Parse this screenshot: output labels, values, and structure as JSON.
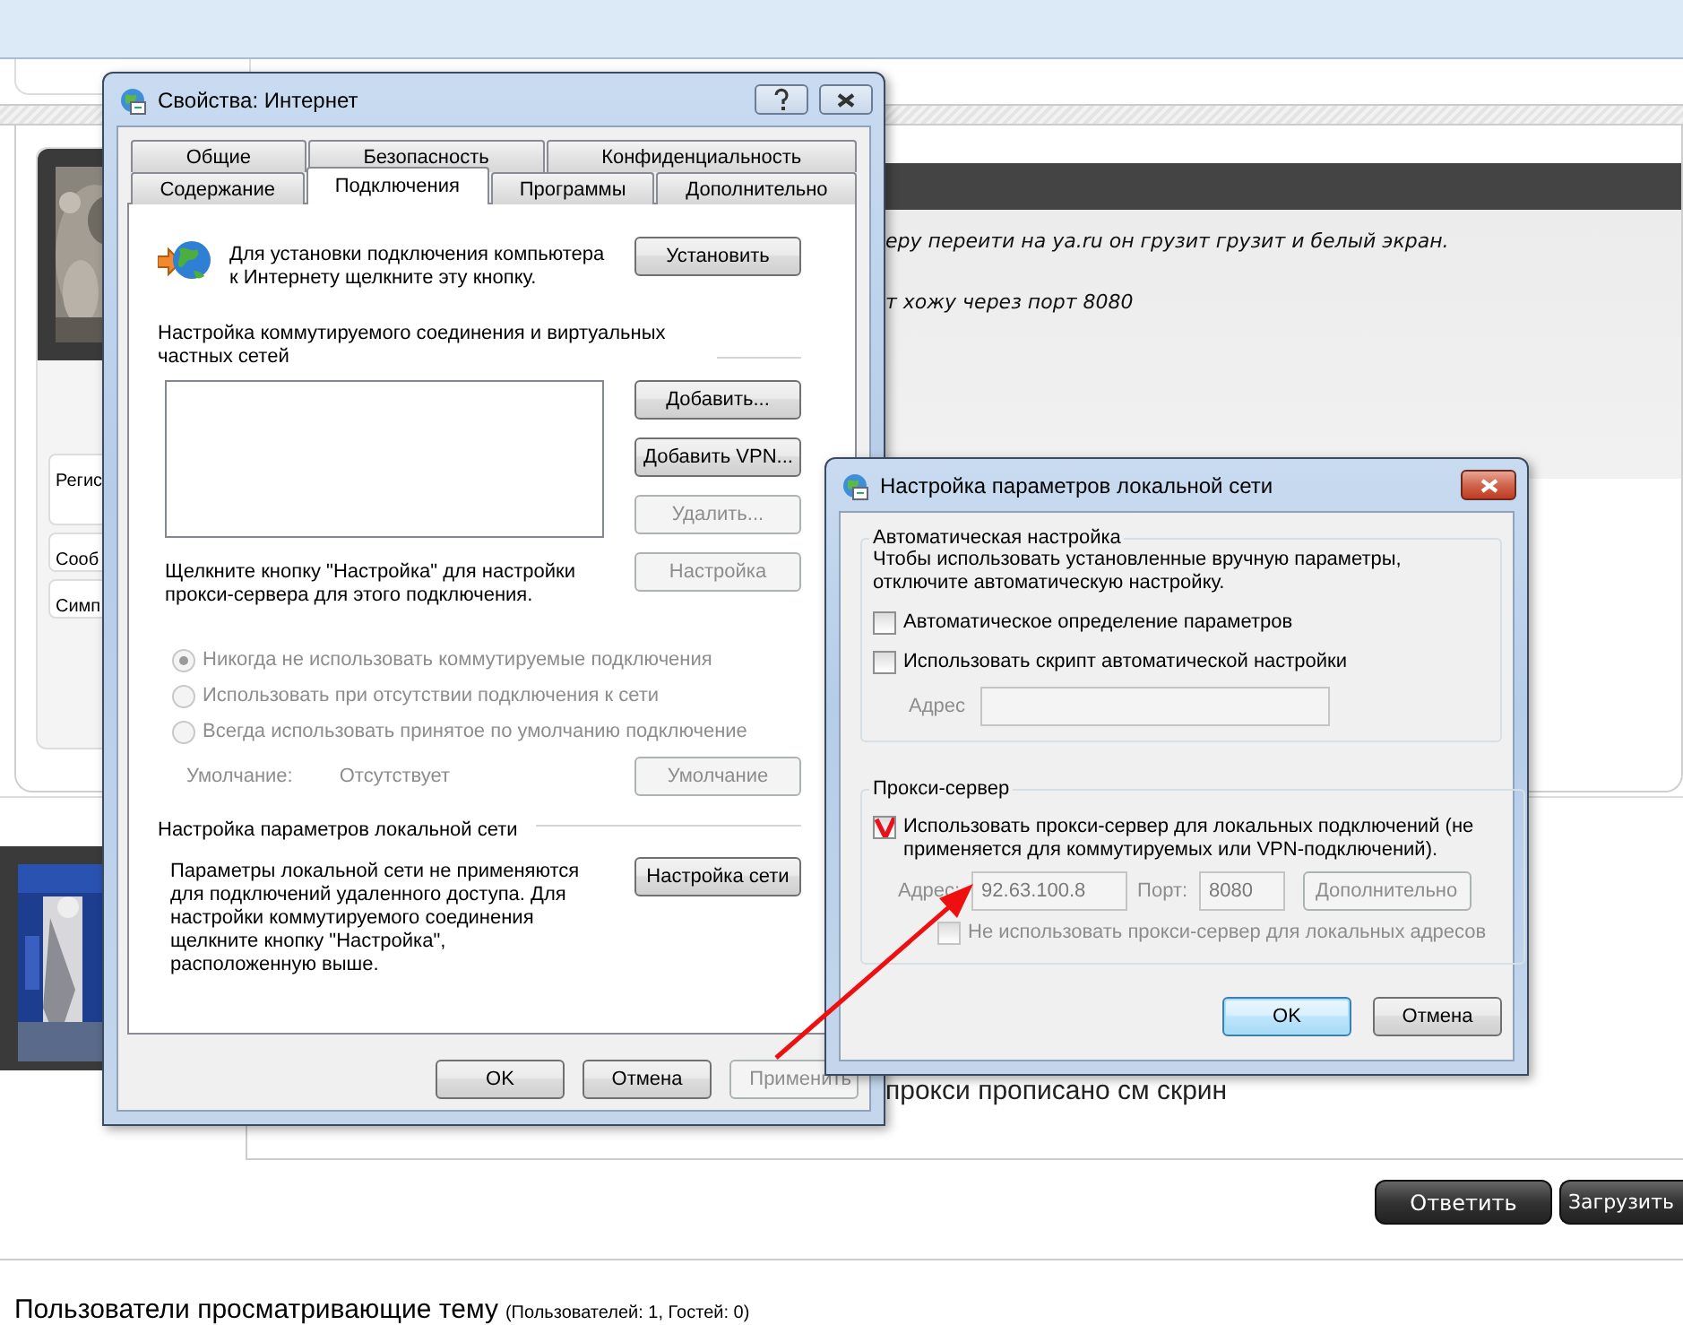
{
  "forum": {
    "post_1": {
      "profile_fields": [
        "Регис",
        "Сооб",
        "Симп"
      ],
      "text_lines": [
        "еру переити на ya.ru он грузит грузит и белый экран.",
        "т хожу через порт 8080"
      ]
    },
    "post_2": {
      "text": "прокси прописано см скрин"
    },
    "actions": [
      "Ответить",
      "Загрузить"
    ],
    "viewers": {
      "title": "Пользователи просматривающие тему",
      "counts": "(Пользователей: 1, Гостей: 0)"
    }
  },
  "internet_properties": {
    "title": "Свойства: Интернет",
    "tab_rows": [
      [
        {
          "label": "Общие",
          "selected": false
        },
        {
          "label": "Безопасность",
          "selected": false
        },
        {
          "label": "Конфиденциальность",
          "selected": false
        }
      ],
      [
        {
          "label": "Содержание",
          "selected": false
        },
        {
          "label": "Подключения",
          "selected": true
        },
        {
          "label": "Программы",
          "selected": false
        },
        {
          "label": "Дополнительно",
          "selected": false
        }
      ]
    ],
    "setup_text": "Для установки подключения компьютера к Интернету щелкните эту кнопку.",
    "setup_button": {
      "label": "Установить",
      "disabled": false
    },
    "dialup_heading": "Настройка коммутируемого соединения и виртуальных частных сетей",
    "dialup_buttons": [
      {
        "label": "Добавить...",
        "disabled": false
      },
      {
        "label": "Добавить VPN...",
        "disabled": false
      },
      {
        "label": "Удалить...",
        "disabled": true
      },
      {
        "label": "Настройка",
        "disabled": true
      }
    ],
    "proxy_hint": "Щелкните кнопку \"Настройка\" для настройки прокси-сервера для этого подключения.",
    "dial_options": [
      {
        "label": "Никогда не использовать коммутируемые подключения",
        "selected": true,
        "disabled": true
      },
      {
        "label": "Использовать при отсутствии подключения к сети",
        "selected": false,
        "disabled": true
      },
      {
        "label": "Всегда использовать принятое по умолчанию подключение",
        "selected": false,
        "disabled": true
      }
    ],
    "default_row": {
      "label": "Умолчание:",
      "value": "Отсутствует",
      "button": {
        "label": "Умолчание",
        "disabled": true
      }
    },
    "lan_heading": "Настройка параметров локальной сети",
    "lan_text": "Параметры локальной сети не применяются для подключений удаленного доступа. Для настройки коммутируемого соединения щелкните кнопку \"Настройка\", расположенную выше.",
    "lan_button": {
      "label": "Настройка сети",
      "disabled": false
    },
    "footer_buttons": [
      {
        "label": "OK",
        "disabled": false
      },
      {
        "label": "Отмена",
        "disabled": false
      },
      {
        "label": "Применить",
        "disabled": true
      }
    ]
  },
  "lan_settings": {
    "title": "Настройка параметров локальной сети",
    "auto_group": {
      "title": "Автоматическая настройка",
      "text": "Чтобы использовать установленные вручную параметры, отключите автоматическую настройку.",
      "checkboxes": [
        {
          "label": "Автоматическое определение параметров",
          "checked": false
        },
        {
          "label": "Использовать скрипт автоматической настройки",
          "checked": false
        }
      ],
      "address": {
        "label": "Адрес",
        "disabled": true
      }
    },
    "proxy_group": {
      "title": "Прокси-сервер",
      "use_proxy": {
        "label": "Использовать прокси-сервер для локальных подключений (не применяется для коммутируемых или VPN-подключений).",
        "checked": true
      },
      "address": {
        "label": "Адрес:",
        "value": "92.63.100.8"
      },
      "port": {
        "label": "Порт:",
        "value": "8080"
      },
      "advanced_button": {
        "label": "Дополнительно",
        "disabled": true
      },
      "bypass": {
        "label": "Не использовать прокси-сервер для локальных адресов",
        "checked": false,
        "disabled": true
      }
    },
    "buttons": [
      {
        "label": "OK",
        "default": true
      },
      {
        "label": "Отмена",
        "default": false
      }
    ]
  }
}
